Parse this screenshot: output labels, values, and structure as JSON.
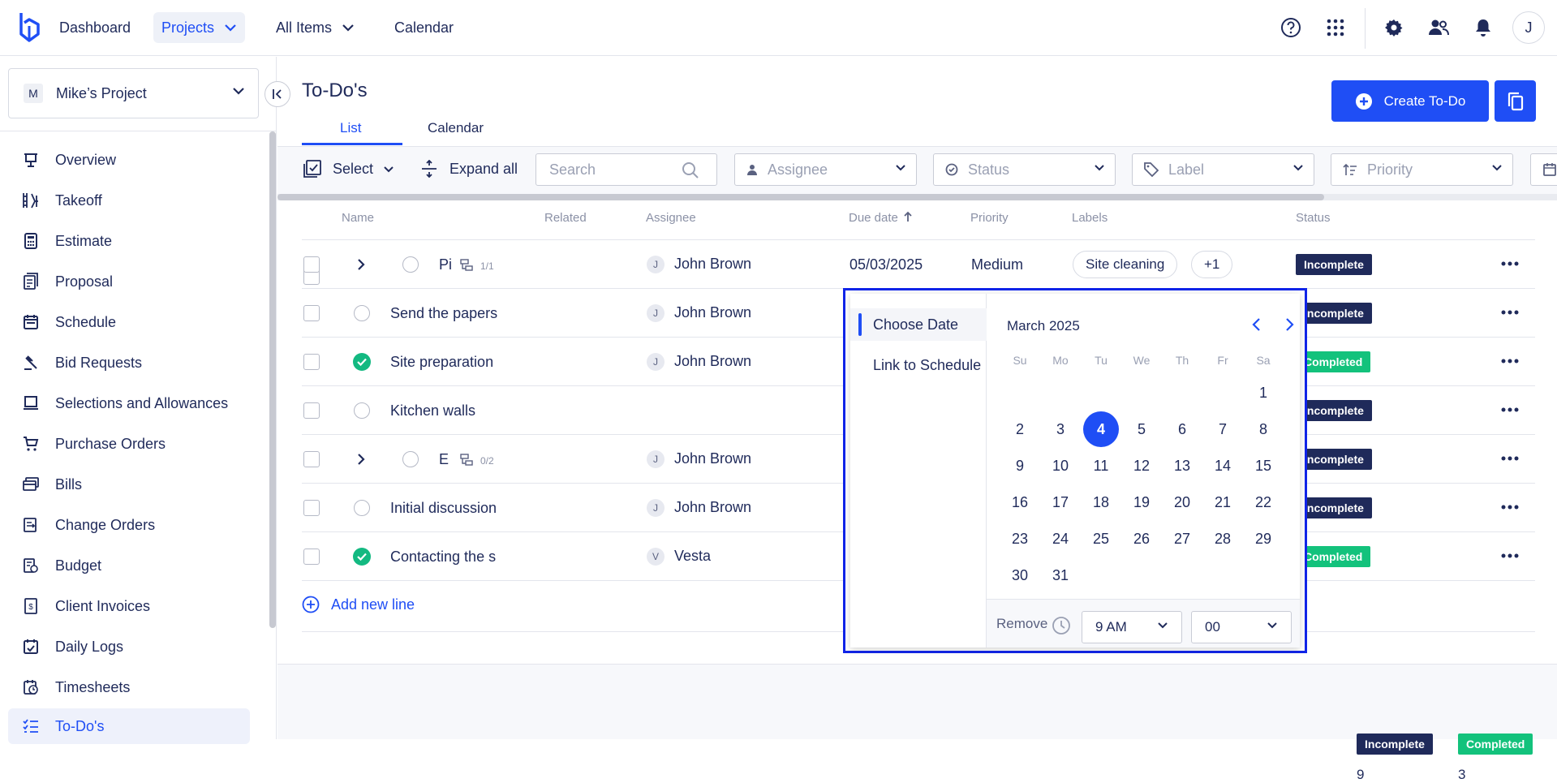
{
  "topnav": {
    "items": [
      {
        "label": "Dashboard"
      },
      {
        "label": "Projects"
      },
      {
        "label": "All Items"
      },
      {
        "label": "Calendar"
      }
    ],
    "avatar_initial": "J"
  },
  "sidebar": {
    "project": {
      "initial": "M",
      "name": "Mike’s Project"
    },
    "items": [
      {
        "label": "Overview",
        "icon": "presentation-icon"
      },
      {
        "label": "Takeoff",
        "icon": "takeoff-icon"
      },
      {
        "label": "Estimate",
        "icon": "calculator-icon"
      },
      {
        "label": "Proposal",
        "icon": "proposal-icon"
      },
      {
        "label": "Schedule",
        "icon": "calendar-icon"
      },
      {
        "label": "Bid Requests",
        "icon": "gavel-icon"
      },
      {
        "label": "Selections and Allowances",
        "icon": "selections-icon"
      },
      {
        "label": "Purchase Orders",
        "icon": "cart-icon"
      },
      {
        "label": "Bills",
        "icon": "bills-icon"
      },
      {
        "label": "Change Orders",
        "icon": "change-orders-icon"
      },
      {
        "label": "Budget",
        "icon": "budget-icon"
      },
      {
        "label": "Client Invoices",
        "icon": "invoice-icon"
      },
      {
        "label": "Daily Logs",
        "icon": "daily-log-icon"
      },
      {
        "label": "Timesheets",
        "icon": "timesheet-icon"
      },
      {
        "label": "To-Do's",
        "icon": "todo-list-icon"
      }
    ]
  },
  "page": {
    "title": "To-Do's",
    "tabs": [
      {
        "label": "List"
      },
      {
        "label": "Calendar"
      }
    ],
    "create_label": "Create To-Do"
  },
  "toolbar": {
    "select_label": "Select",
    "expand_label": "Expand all",
    "search_placeholder": "Search",
    "filters": [
      {
        "placeholder": "Assignee"
      },
      {
        "placeholder": "Status"
      },
      {
        "placeholder": "Label"
      },
      {
        "placeholder": "Priority"
      }
    ]
  },
  "table": {
    "columns": [
      "Name",
      "Related",
      "Assignee",
      "Due date",
      "Priority",
      "Labels",
      "Status"
    ],
    "rows": [
      {
        "name": "Pi",
        "subtasks": "1/1",
        "assignee_initial": "J",
        "assignee": "John Brown",
        "due": "05/03/2025",
        "priority": "Medium",
        "labels": [
          "Site cleaning",
          "+1"
        ],
        "status": "Incomplete"
      },
      {
        "name": "Send the papers",
        "assignee_initial": "J",
        "assignee": "John Brown",
        "status": "Incomplete"
      },
      {
        "name": "Site preparation",
        "assignee_initial": "J",
        "assignee": "John Brown",
        "status": "Completed"
      },
      {
        "name": "Kitchen walls",
        "status": "Incomplete"
      },
      {
        "name": "E",
        "subtasks": "0/2",
        "assignee_initial": "J",
        "assignee": "John Brown",
        "status": "Incomplete"
      },
      {
        "name": "Initial discussion",
        "assignee_initial": "J",
        "assignee": "John Brown",
        "status": "Incomplete"
      },
      {
        "name": "Contacting the s",
        "assignee_initial": "V",
        "assignee": "Vesta",
        "status": "Completed"
      }
    ],
    "add_line_label": "Add new line"
  },
  "datepicker": {
    "options": [
      "Choose Date",
      "Link to Schedule"
    ],
    "month_label": "March 2025",
    "weekdays": [
      "Su",
      "Mo",
      "Tu",
      "We",
      "Th",
      "Fr",
      "Sa"
    ],
    "days": [
      "1",
      "2",
      "3",
      "4",
      "5",
      "6",
      "7",
      "8",
      "9",
      "10",
      "11",
      "12",
      "13",
      "14",
      "15",
      "16",
      "17",
      "18",
      "19",
      "20",
      "21",
      "22",
      "23",
      "24",
      "25",
      "26",
      "27",
      "28",
      "29",
      "30",
      "31"
    ],
    "selected_day": "4",
    "remove_label": "Remove",
    "hour": "9 AM",
    "minute": "00"
  },
  "summary": {
    "incomplete_label": "Incomplete",
    "incomplete_count": "9",
    "completed_label": "Completed",
    "completed_count": "3"
  },
  "colors": {
    "accent": "#1f4ef5",
    "incomplete": "#1f2a5a",
    "completed": "#13c27c",
    "popup_border": "#1125e8"
  }
}
